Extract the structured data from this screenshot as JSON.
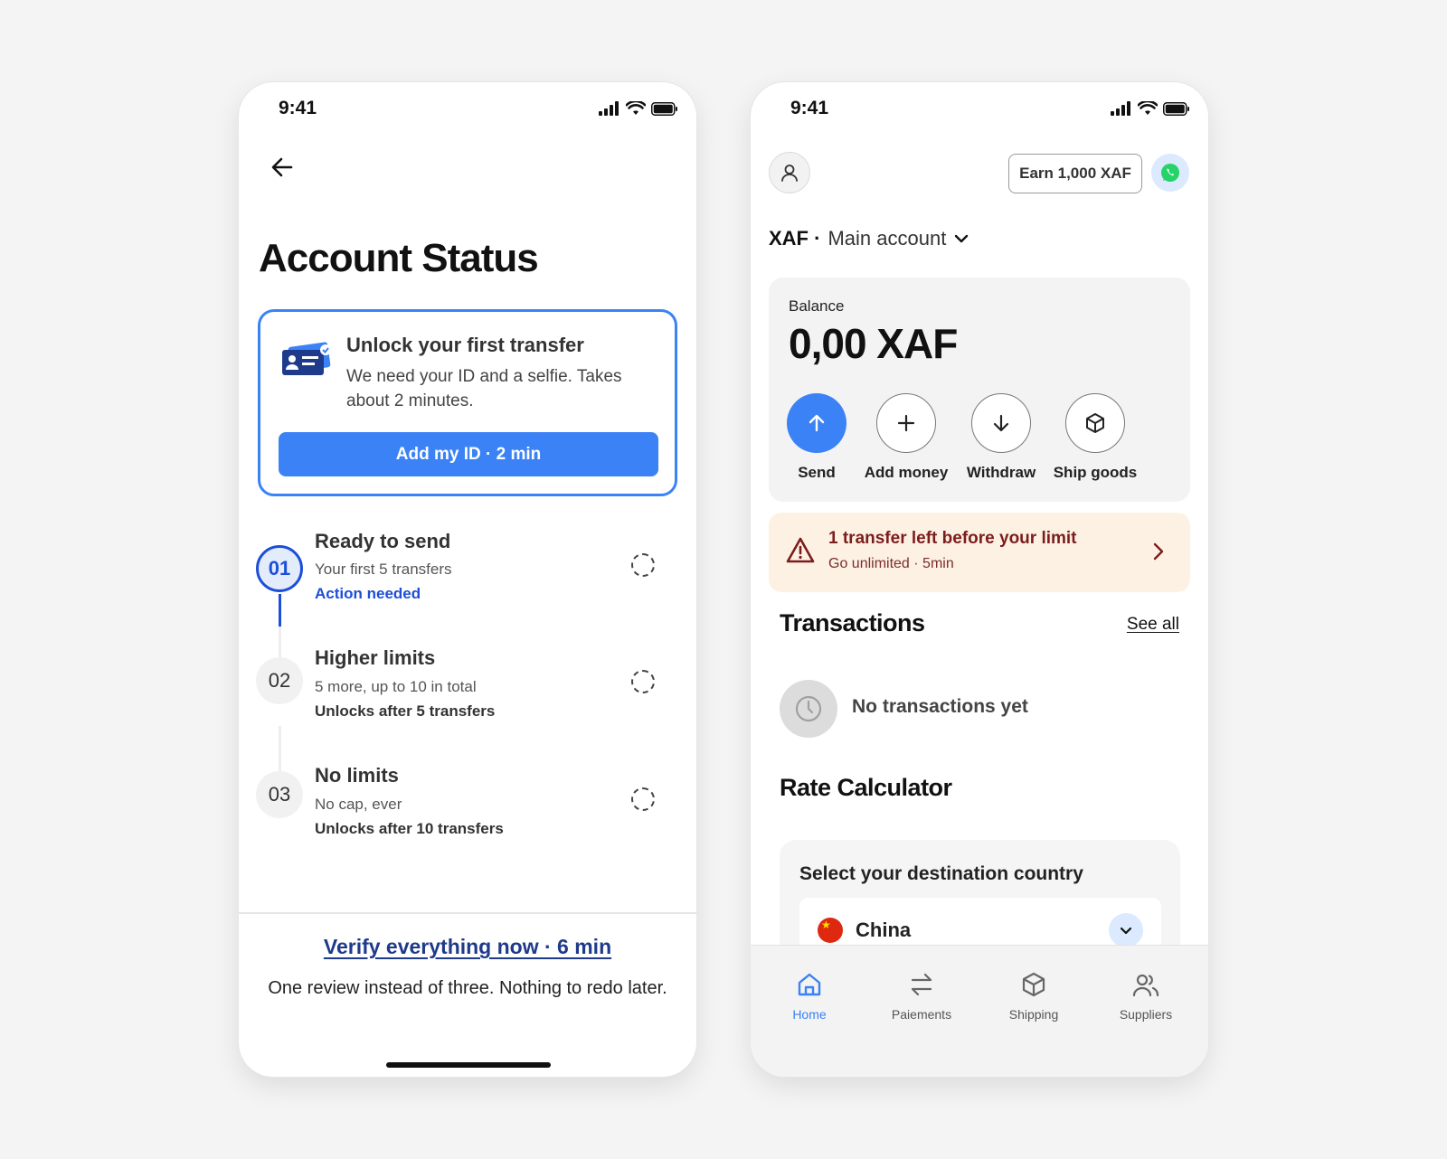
{
  "left_screen": {
    "status_time": "9:41",
    "title": "Account Status",
    "unlock_card": {
      "title": "Unlock your first transfer",
      "description": "We need your ID and a selfie. Takes about 2 minutes.",
      "button_label": "Add my ID · 2 min"
    },
    "steps": [
      {
        "number": "01",
        "title": "Ready to send",
        "subtitle": "Your first 5 transfers",
        "note": "Action needed"
      },
      {
        "number": "02",
        "title": "Higher limits",
        "subtitle": "5 more, up to 10 in total",
        "note": "Unlocks after 5 transfers"
      },
      {
        "number": "03",
        "title": "No limits",
        "subtitle": "No cap, ever",
        "note": "Unlocks after 10 transfers"
      }
    ],
    "verify_link": "Verify everything now · 6 min",
    "verify_note": "One review instead of three. Nothing to redo later."
  },
  "right_screen": {
    "status_time": "9:41",
    "earn_button": "Earn 1,000 XAF",
    "account": {
      "currency": "XAF ·",
      "name": "Main account"
    },
    "balance": {
      "label": "Balance",
      "value": "0,00 XAF"
    },
    "actions": [
      {
        "label": "Send",
        "icon": "arrow-up-icon"
      },
      {
        "label": "Add money",
        "icon": "plus-icon"
      },
      {
        "label": "Withdraw",
        "icon": "arrow-down-icon"
      },
      {
        "label": "Ship goods",
        "icon": "box-icon"
      }
    ],
    "limit_banner": {
      "title": "1 transfer left before your limit",
      "subtitle": "Go unlimited · 5min"
    },
    "transactions": {
      "title": "Transactions",
      "see_all": "See all",
      "empty": "No transactions yet"
    },
    "rate_calculator": {
      "title": "Rate Calculator",
      "select_label": "Select your destination country",
      "country": "China"
    },
    "tabs": [
      {
        "label": "Home",
        "icon": "home-icon",
        "active": true
      },
      {
        "label": "Paiements",
        "icon": "transfer-arrows-icon",
        "active": false
      },
      {
        "label": "Shipping",
        "icon": "box-icon",
        "active": false
      },
      {
        "label": "Suppliers",
        "icon": "users-icon",
        "active": false
      }
    ]
  },
  "colors": {
    "accent_blue": "#3b82f6",
    "step_blue": "#1d4ed8",
    "link_navy": "#1e3a8a",
    "warning_bg": "#fdf1e4",
    "warning_text": "#7c1d1d",
    "whatsapp_green": "#25d366"
  }
}
